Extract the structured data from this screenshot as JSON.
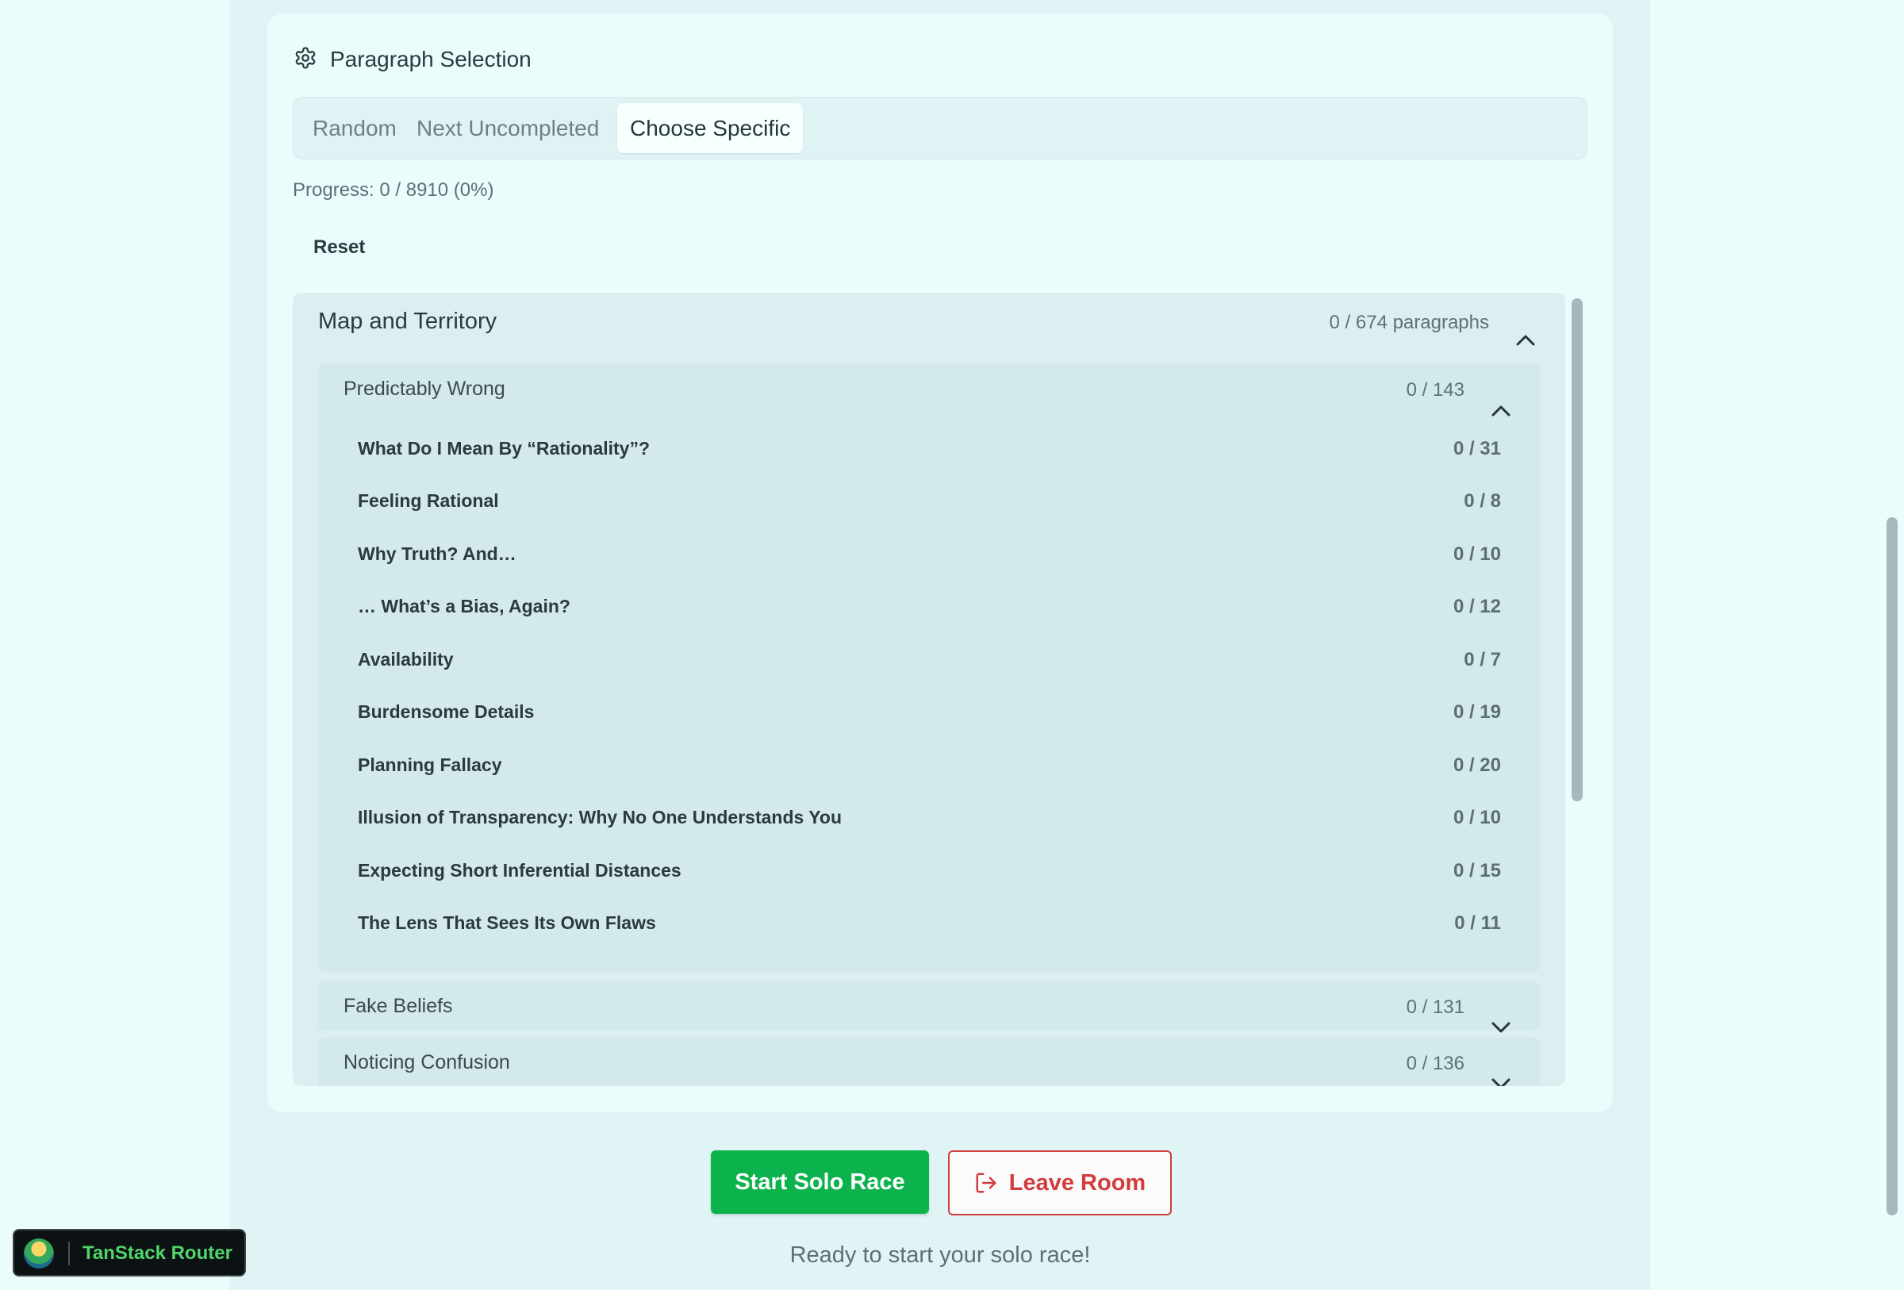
{
  "header": {
    "title": "Paragraph Selection",
    "icon": "gear-icon"
  },
  "tabs": [
    {
      "label": "Random",
      "active": false
    },
    {
      "label": "Next Uncompleted",
      "active": false
    },
    {
      "label": "Choose Specific",
      "active": true
    }
  ],
  "progress": {
    "text": "Progress: 0 / 8910 (0%)"
  },
  "reset_label": "Reset",
  "book": {
    "title": "Map and Territory",
    "count": "0 / 674 paragraphs",
    "expanded": true,
    "sequences": [
      {
        "title": "Predictably Wrong",
        "count": "0 / 143",
        "expanded": true,
        "posts": [
          {
            "title": "What Do I Mean By “Rationality”?",
            "count": "0 / 31"
          },
          {
            "title": "Feeling Rational",
            "count": "0 / 8"
          },
          {
            "title": "Why Truth? And…",
            "count": "0 / 10"
          },
          {
            "title": "… What’s a Bias, Again?",
            "count": "0 / 12"
          },
          {
            "title": "Availability",
            "count": "0 / 7"
          },
          {
            "title": "Burdensome Details",
            "count": "0 / 19"
          },
          {
            "title": "Planning Fallacy",
            "count": "0 / 20"
          },
          {
            "title": "Illusion of Transparency: Why No One Understands You",
            "count": "0 / 10"
          },
          {
            "title": "Expecting Short Inferential Distances",
            "count": "0 / 15"
          },
          {
            "title": "The Lens That Sees Its Own Flaws",
            "count": "0 / 11"
          }
        ]
      },
      {
        "title": "Fake Beliefs",
        "count": "0 / 131",
        "expanded": false
      },
      {
        "title": "Noticing Confusion",
        "count": "0 / 136",
        "expanded": false
      }
    ]
  },
  "actions": {
    "start_label": "Start Solo Race",
    "leave_label": "Leave Room"
  },
  "status": "Ready to start your solo race!",
  "devtools": {
    "label": "TanStack Router"
  },
  "colors": {
    "primary_green": "#0cb24c",
    "danger_red": "#d13c3c",
    "background": "#ebfcfc"
  }
}
